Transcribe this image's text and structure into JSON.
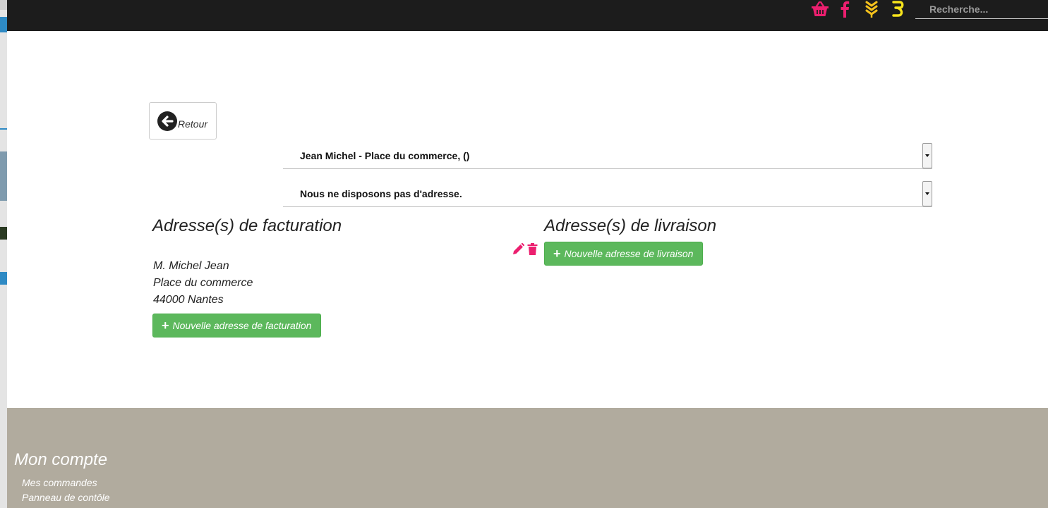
{
  "header": {
    "search_placeholder": "Recherche...",
    "icons": [
      "basket-icon",
      "facebook-icon",
      "wheat-icon",
      "coin-icon"
    ],
    "colors": {
      "bar": "#1c1c1c",
      "pink": "#ec1f6f",
      "gold": "#f6c21c"
    }
  },
  "back_button": {
    "label": "Retour"
  },
  "selects": {
    "billing_selected": "Jean Michel - Place du commerce, ()",
    "shipping_selected": "Nous ne disposons pas d'adresse."
  },
  "billing": {
    "title": "Adresse(s) de facturation",
    "address": {
      "name": "M. Michel Jean",
      "street": "Place du commerce",
      "city": "44000 Nantes"
    },
    "new_button": "Nouvelle adresse de facturation"
  },
  "shipping": {
    "title": "Adresse(s) de livraison",
    "new_button": "Nouvelle adresse de livraison"
  },
  "footer": {
    "title": "Mon compte",
    "links": [
      "Mes commandes",
      "Panneau de contôle"
    ]
  },
  "accent_colors": {
    "green": "#5cb85c",
    "footer": "#b1ab9e"
  }
}
